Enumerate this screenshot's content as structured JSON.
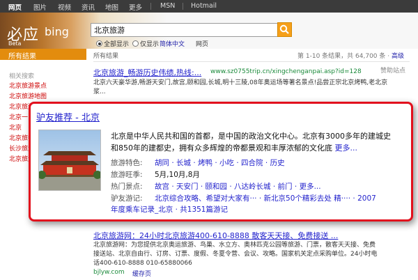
{
  "topnav": {
    "items": [
      "网页",
      "图片",
      "视频",
      "资讯",
      "地图",
      "更多",
      "MSN",
      "Hotmail"
    ],
    "active": "网页"
  },
  "header": {
    "logo_cn": "必应",
    "logo_bing": "bing",
    "beta": "Beta",
    "search_value": "北京旅游",
    "filters": {
      "all": "全部显示",
      "only": "仅显示",
      "simplified": "简体中文",
      "webpage": "网页"
    }
  },
  "sidebar": {
    "all_results": "所有结果",
    "related_title": "相关搜索",
    "related": [
      "北京旅游景点",
      "北京旅游地图",
      "北京旅游攻略",
      "北京一日游",
      "北京",
      "北京旅行社",
      "长沙旅游",
      "北京旅游网"
    ]
  },
  "results_meta": {
    "label": "所有结果",
    "count": "第 1-10 条结果，共 64,700 条",
    "advanced": "高级",
    "sponsor": "赞助站点"
  },
  "ad": {
    "title": "北京旅游_畅游历史伟绩,热线:...",
    "url": "www.sz0755trip.cn/xingchenganpai.asp?id=128",
    "desc_line1": "北京六天豪华游,畅游天安门,故宫,颐和园,长城,明十三陵,08年奥运场等著名景点!品尝正宗北京烤鸭,老北京",
    "desc_line2": "浆..."
  },
  "popup": {
    "title": "驴友推荐 - 北京",
    "intro_line1": "北京是中华人民共和国的首都，是中国的政治文化中心。北京有3000多年的建城史",
    "intro_line2": "和850年的建都史，拥有众多辉煌的帝都景观和丰厚浓郁的文化底",
    "more": "更多...",
    "rows": {
      "features_label": "旅游特色:",
      "features_value": "胡同 · 长城 · 烤鸭 · 小吃 · 四合院 · 历史",
      "season_label": "旅游旺季:",
      "season_value": "5月,10月,8月",
      "spots_label": "热门景点:",
      "spots_value": "故宫 · 天安门 · 颐和园 · 八达岭长城 · 前门 · 更多...",
      "tips_label": "驴友游记:",
      "tips_value": "北京综合攻略、希望对大家有··· · 新北京50个精彩去处 精···· · 2007",
      "tips_value_line2": "年度乘车记录_北京 · 共1351篇游记"
    }
  },
  "result2": {
    "title": "北京旅游网：24小时北京旅游400-610-8888 散客天天接、免费接送 ...",
    "desc_line1": "北京旅游网：为您提供北京奥运旅游、鸟巢、水立方、奥林匹克公园等旅游、门票，散客天天接、免费",
    "desc_line2": "接送站、北京自由行、订房、订票、度假、冬夏令营、会议、攻略。国家机关定点采购单位。24小时电",
    "desc_line3": "话400-610-8888 010-65880066",
    "url": "bjlyw.com",
    "cache": "缓存页"
  },
  "colors": {
    "accent_orange": "#e38c0e",
    "popup_border": "#e2101d",
    "link_blue": "#2222cc",
    "url_green": "#1a8a3a",
    "highlight_red": "#cc0000"
  }
}
